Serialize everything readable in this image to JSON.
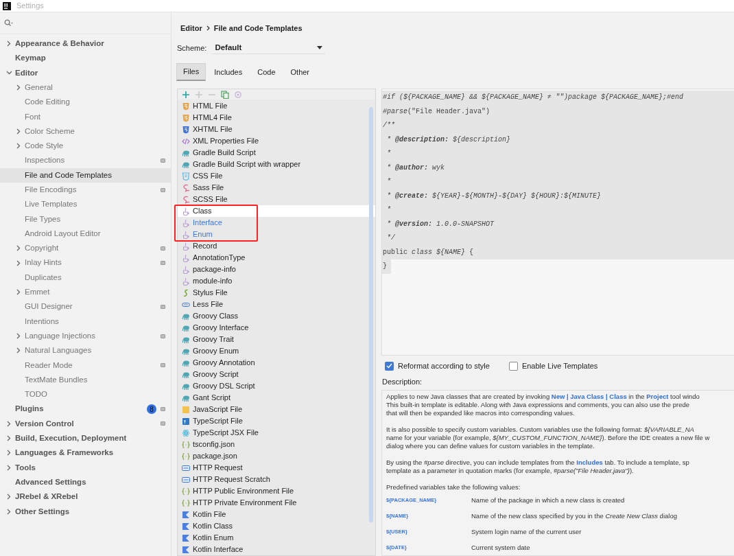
{
  "window": {
    "title": "Settings"
  },
  "sidebar": {
    "items": [
      {
        "label": "Appearance & Behavior",
        "kind": "group",
        "expanded": false,
        "selected": false,
        "project_level": false
      },
      {
        "label": "Keymap",
        "kind": "page",
        "selected": false,
        "project_level": false
      },
      {
        "label": "Editor",
        "kind": "group",
        "expanded": true,
        "selected": false,
        "project_level": false,
        "children": [
          {
            "label": "General",
            "kind": "group",
            "expanded": false,
            "selected": false,
            "project_level": false
          },
          {
            "label": "Code Editing",
            "kind": "page",
            "selected": false,
            "project_level": false
          },
          {
            "label": "Font",
            "kind": "page",
            "selected": false,
            "project_level": false
          },
          {
            "label": "Color Scheme",
            "kind": "group",
            "expanded": false,
            "selected": false,
            "project_level": false
          },
          {
            "label": "Code Style",
            "kind": "group",
            "expanded": false,
            "selected": false,
            "project_level": false
          },
          {
            "label": "Inspections",
            "kind": "page",
            "selected": false,
            "project_level": true
          },
          {
            "label": "File and Code Templates",
            "kind": "page",
            "selected": true,
            "project_level": false
          },
          {
            "label": "File Encodings",
            "kind": "page",
            "selected": false,
            "project_level": true
          },
          {
            "label": "Live Templates",
            "kind": "page",
            "selected": false,
            "project_level": false
          },
          {
            "label": "File Types",
            "kind": "page",
            "selected": false,
            "project_level": false
          },
          {
            "label": "Android Layout Editor",
            "kind": "page",
            "selected": false,
            "project_level": false
          },
          {
            "label": "Copyright",
            "kind": "group",
            "expanded": false,
            "selected": false,
            "project_level": true
          },
          {
            "label": "Inlay Hints",
            "kind": "group",
            "expanded": false,
            "selected": false,
            "project_level": true
          },
          {
            "label": "Duplicates",
            "kind": "page",
            "selected": false,
            "project_level": false
          },
          {
            "label": "Emmet",
            "kind": "group",
            "expanded": false,
            "selected": false,
            "project_level": false
          },
          {
            "label": "GUI Designer",
            "kind": "page",
            "selected": false,
            "project_level": true
          },
          {
            "label": "Intentions",
            "kind": "page",
            "selected": false,
            "project_level": false
          },
          {
            "label": "Language Injections",
            "kind": "group",
            "expanded": false,
            "selected": false,
            "project_level": true
          },
          {
            "label": "Natural Languages",
            "kind": "group",
            "expanded": false,
            "selected": false,
            "project_level": false
          },
          {
            "label": "Reader Mode",
            "kind": "page",
            "selected": false,
            "project_level": true
          },
          {
            "label": "TextMate Bundles",
            "kind": "page",
            "selected": false,
            "project_level": false
          },
          {
            "label": "TODO",
            "kind": "page",
            "selected": false,
            "project_level": false
          }
        ]
      },
      {
        "label": "Plugins",
        "kind": "page",
        "selected": false,
        "project_level": true,
        "badge": "8"
      },
      {
        "label": "Version Control",
        "kind": "group",
        "expanded": false,
        "selected": false,
        "project_level": true
      },
      {
        "label": "Build, Execution, Deployment",
        "kind": "group",
        "expanded": false,
        "selected": false,
        "project_level": false
      },
      {
        "label": "Languages & Frameworks",
        "kind": "group",
        "expanded": false,
        "selected": false,
        "project_level": false
      },
      {
        "label": "Tools",
        "kind": "group",
        "expanded": false,
        "selected": false,
        "project_level": false
      },
      {
        "label": "Advanced Settings",
        "kind": "page",
        "selected": false,
        "project_level": false
      },
      {
        "label": "JRebel & XRebel",
        "kind": "group",
        "expanded": false,
        "selected": false,
        "project_level": false
      },
      {
        "label": "Other Settings",
        "kind": "group",
        "expanded": false,
        "selected": false,
        "project_level": false
      }
    ]
  },
  "breadcrumb": [
    "Editor",
    "File and Code Templates"
  ],
  "scheme": {
    "label": "Scheme:",
    "value": "Default"
  },
  "tabs": [
    {
      "label": "Files",
      "selected": true
    },
    {
      "label": "Includes",
      "selected": false
    },
    {
      "label": "Code",
      "selected": false
    },
    {
      "label": "Other",
      "selected": false
    }
  ],
  "toolbar": [
    {
      "kind": "add",
      "disabled": false
    },
    {
      "kind": "add",
      "disabled": true
    },
    {
      "kind": "remove",
      "disabled": true
    },
    {
      "kind": "copy",
      "disabled": false
    },
    {
      "kind": "reset",
      "disabled": true
    }
  ],
  "templates": [
    {
      "label": "HTML File",
      "kind": "html",
      "selected": false,
      "modified": false,
      "framed": false
    },
    {
      "label": "HTML4 File",
      "kind": "html",
      "selected": false,
      "modified": false,
      "framed": false
    },
    {
      "label": "XHTML File",
      "kind": "xhtml",
      "selected": false,
      "modified": false,
      "framed": false
    },
    {
      "label": "XML Properties File",
      "kind": "xml",
      "selected": false,
      "modified": false,
      "framed": false
    },
    {
      "label": "Gradle Build Script",
      "kind": "groovy",
      "selected": false,
      "modified": false,
      "framed": false
    },
    {
      "label": "Gradle Build Script with wrapper",
      "kind": "groovy",
      "selected": false,
      "modified": false,
      "framed": false
    },
    {
      "label": "CSS File",
      "kind": "css",
      "selected": false,
      "modified": false,
      "framed": false
    },
    {
      "label": "Sass File",
      "kind": "sass",
      "selected": false,
      "modified": false,
      "framed": false
    },
    {
      "label": "SCSS File",
      "kind": "sass",
      "selected": false,
      "modified": false,
      "framed": false
    },
    {
      "label": "Class",
      "kind": "java",
      "selected": true,
      "modified": false,
      "framed": true
    },
    {
      "label": "Interface",
      "kind": "java",
      "selected": false,
      "modified": true,
      "framed": true
    },
    {
      "label": "Enum",
      "kind": "java",
      "selected": false,
      "modified": true,
      "framed": true
    },
    {
      "label": "Record",
      "kind": "java",
      "selected": false,
      "modified": false,
      "framed": false
    },
    {
      "label": "AnnotationType",
      "kind": "java",
      "selected": false,
      "modified": false,
      "framed": false
    },
    {
      "label": "package-info",
      "kind": "java",
      "selected": false,
      "modified": false,
      "framed": false
    },
    {
      "label": "module-info",
      "kind": "java",
      "selected": false,
      "modified": false,
      "framed": false
    },
    {
      "label": "Stylus File",
      "kind": "stylus",
      "selected": false,
      "modified": false,
      "framed": false
    },
    {
      "label": "Less File",
      "kind": "less",
      "selected": false,
      "modified": false,
      "framed": false
    },
    {
      "label": "Groovy Class",
      "kind": "groovy",
      "selected": false,
      "modified": false,
      "framed": false
    },
    {
      "label": "Groovy Interface",
      "kind": "groovy",
      "selected": false,
      "modified": false,
      "framed": false
    },
    {
      "label": "Groovy Trait",
      "kind": "groovy",
      "selected": false,
      "modified": false,
      "framed": false
    },
    {
      "label": "Groovy Enum",
      "kind": "groovy",
      "selected": false,
      "modified": false,
      "framed": false
    },
    {
      "label": "Groovy Annotation",
      "kind": "groovy",
      "selected": false,
      "modified": false,
      "framed": false
    },
    {
      "label": "Groovy Script",
      "kind": "groovy",
      "selected": false,
      "modified": false,
      "framed": false
    },
    {
      "label": "Groovy DSL Script",
      "kind": "groovy",
      "selected": false,
      "modified": false,
      "framed": false
    },
    {
      "label": "Gant Script",
      "kind": "groovy",
      "selected": false,
      "modified": false,
      "framed": false
    },
    {
      "label": "JavaScript File",
      "kind": "js",
      "selected": false,
      "modified": false,
      "framed": false
    },
    {
      "label": "TypeScript File",
      "kind": "ts",
      "selected": false,
      "modified": false,
      "framed": false
    },
    {
      "label": "TypeScript JSX File",
      "kind": "react",
      "selected": false,
      "modified": false,
      "framed": false
    },
    {
      "label": "tsconfig.json",
      "kind": "json",
      "selected": false,
      "modified": false,
      "framed": false
    },
    {
      "label": "package.json",
      "kind": "json",
      "selected": false,
      "modified": false,
      "framed": false
    },
    {
      "label": "HTTP Request",
      "kind": "http",
      "selected": false,
      "modified": false,
      "framed": false
    },
    {
      "label": "HTTP Request Scratch",
      "kind": "http",
      "selected": false,
      "modified": false,
      "framed": false
    },
    {
      "label": "HTTP Public Environment File",
      "kind": "json",
      "selected": false,
      "modified": false,
      "framed": false
    },
    {
      "label": "HTTP Private Environment File",
      "kind": "json",
      "selected": false,
      "modified": false,
      "framed": false
    },
    {
      "label": "Kotlin File",
      "kind": "kotlin",
      "selected": false,
      "modified": false,
      "framed": false
    },
    {
      "label": "Kotlin Class",
      "kind": "kotlin",
      "selected": false,
      "modified": false,
      "framed": false
    },
    {
      "label": "Kotlin Enum",
      "kind": "kotlin",
      "selected": false,
      "modified": false,
      "framed": false
    },
    {
      "label": "Kotlin Interface",
      "kind": "kotlin",
      "selected": false,
      "modified": false,
      "framed": false
    }
  ],
  "editor": {
    "lines": [
      [
        {
          "kind": "var",
          "text": "#if (${PACKAGE_NAME} && ${PACKAGE_NAME} ≠ \"\")package ${PACKAGE_NAME};#end"
        }
      ],
      [
        {
          "kind": "var",
          "text": "#parse"
        },
        {
          "kind": "plain",
          "text": "(\"File Header.java\")"
        }
      ],
      [
        {
          "kind": "var",
          "text": "/**"
        }
      ],
      [
        {
          "kind": "var",
          "text": " * "
        },
        {
          "kind": "tag",
          "text": "@description:"
        },
        {
          "kind": "var",
          "text": " ${description}"
        }
      ],
      [
        {
          "kind": "var",
          "text": " *"
        }
      ],
      [
        {
          "kind": "var",
          "text": " * "
        },
        {
          "kind": "tag",
          "text": "@author:"
        },
        {
          "kind": "var",
          "text": " wyk"
        }
      ],
      [
        {
          "kind": "var",
          "text": " *"
        }
      ],
      [
        {
          "kind": "var",
          "text": " * "
        },
        {
          "kind": "tag",
          "text": "@create:"
        },
        {
          "kind": "var",
          "text": " ${YEAR}-${MONTH}-${DAY} ${HOUR}:${MINUTE}"
        }
      ],
      [
        {
          "kind": "var",
          "text": " *"
        }
      ],
      [
        {
          "kind": "var",
          "text": " * "
        },
        {
          "kind": "tag",
          "text": "@version:"
        },
        {
          "kind": "var",
          "text": " 1.0.0-SNAPSHOT"
        }
      ],
      [
        {
          "kind": "var",
          "text": " */"
        }
      ],
      [
        {
          "kind": "plain",
          "text": "public "
        },
        {
          "kind": "var",
          "text": "class ${NAME}"
        },
        {
          "kind": "plain",
          "text": " {"
        }
      ],
      [
        {
          "kind": "plain",
          "text": "}"
        }
      ]
    ]
  },
  "options": [
    {
      "label": "Reformat according to style",
      "checked": true
    },
    {
      "label": "Enable Live Templates",
      "checked": false
    }
  ],
  "description": {
    "label": "Description:",
    "paragraphs": [
      [
        [
          {
            "kind": "text",
            "text": "Applies to new Java classes that are created by invoking "
          },
          {
            "kind": "link",
            "text": "New | Java Class | Class"
          },
          {
            "kind": "text",
            "text": " in the "
          },
          {
            "kind": "link",
            "text": "Project"
          },
          {
            "kind": "text",
            "text": " tool windo"
          }
        ],
        [
          {
            "kind": "text",
            "text": "This built-in template is editable. Along with Java expressions and comments, you can also use the prede"
          }
        ],
        [
          {
            "kind": "text",
            "text": "that will then be expanded like macros into corresponding values."
          }
        ]
      ],
      [
        [
          {
            "kind": "text",
            "text": "It is also possible to specify custom variables. Custom variables use the following format: *${VARIABLE_NA*"
          }
        ],
        [
          {
            "kind": "text",
            "text": "name for your variable (for example, *${MY_CUSTOM_FUNCTION_NAME}*). Before the IDE creates a new file w"
          }
        ],
        [
          {
            "kind": "text",
            "text": "dialog where you can define values for custom variables in the template."
          }
        ]
      ],
      [
        [
          {
            "kind": "text",
            "text": "By using the *#parse* directive, you can include templates from the "
          },
          {
            "kind": "link",
            "text": "Includes"
          },
          {
            "kind": "text",
            "text": " tab. To include a template, sp"
          }
        ],
        [
          {
            "kind": "text",
            "text": "template as a parameter in quotation marks (for example, *#parse(\"File Header.java\")*)."
          }
        ]
      ],
      [
        [
          {
            "kind": "text",
            "text": "Predefined variables take the following values:"
          }
        ]
      ]
    ],
    "variables": [
      {
        "name": "${PACKAGE_NAME}",
        "text": "Name of the package in which a new class is created"
      },
      {
        "name": "${NAME}",
        "text": "Name of the new class specified by you in the *Create New Class* dialog"
      },
      {
        "name": "${USER}",
        "text": "System login name of the current user"
      },
      {
        "name": "${DATE}",
        "text": "Current system date"
      }
    ]
  }
}
